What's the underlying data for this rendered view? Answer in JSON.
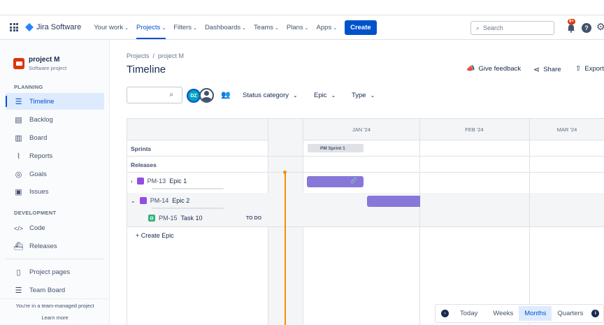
{
  "nav": {
    "product": "Jira Software",
    "items": [
      {
        "label": "Your work",
        "chevron": true,
        "active": false
      },
      {
        "label": "Projects",
        "chevron": true,
        "active": true
      },
      {
        "label": "Filters",
        "chevron": true,
        "active": false
      },
      {
        "label": "Dashboards",
        "chevron": true,
        "active": false
      },
      {
        "label": "Teams",
        "chevron": true,
        "active": false
      },
      {
        "label": "Plans",
        "chevron": true,
        "active": false
      },
      {
        "label": "Apps",
        "chevron": true,
        "active": false
      }
    ],
    "create_label": "Create",
    "search_placeholder": "Search",
    "notification_badge": "9+"
  },
  "sidebar": {
    "project_name": "project M",
    "project_type": "Software project",
    "planning_heading": "PLANNING",
    "planning_items": [
      "Timeline",
      "Backlog",
      "Board",
      "Reports",
      "Goals",
      "Issues"
    ],
    "development_heading": "DEVELOPMENT",
    "development_items": [
      "Code",
      "Releases"
    ],
    "extra_items": [
      "Project pages",
      "Team Board"
    ],
    "footer_text": "You're in a team-managed project",
    "learn_more": "Learn more"
  },
  "page": {
    "breadcrumb_root": "Projects",
    "breadcrumb_sep": "/",
    "breadcrumb_project": "project M",
    "title": "Timeline",
    "give_feedback": "Give feedback",
    "share": "Share",
    "export": "Export"
  },
  "filters": {
    "avatar_initials": "DZ",
    "status_category": "Status category",
    "epic": "Epic",
    "type": "Type"
  },
  "timeline": {
    "months": [
      "JAN '24",
      "FEB '24",
      "MAR '24"
    ],
    "sprints_label": "Sprints",
    "sprint_name": "PM Sprint 1",
    "releases_label": "Releases",
    "rows": [
      {
        "key": "PM-13",
        "name": "Epic 1",
        "kind": "epic",
        "expanded": false,
        "status": ""
      },
      {
        "key": "PM-14",
        "name": "Epic 2",
        "kind": "epic",
        "expanded": true,
        "status": ""
      },
      {
        "key": "PM-15",
        "name": "Task 10",
        "kind": "task",
        "expanded": false,
        "status": "TO DO"
      }
    ],
    "create_epic": "+ Create Epic"
  },
  "view_controls": {
    "today": "Today",
    "options": [
      "Weeks",
      "Months",
      "Quarters"
    ],
    "selected": "Months"
  },
  "colors": {
    "brand_blue": "#0052cc",
    "epic_purple": "#8777d9",
    "epic_icon": "#904ee2",
    "task_green": "#36b37e",
    "today_line": "#ff8b00",
    "notification_red": "#de350b"
  }
}
